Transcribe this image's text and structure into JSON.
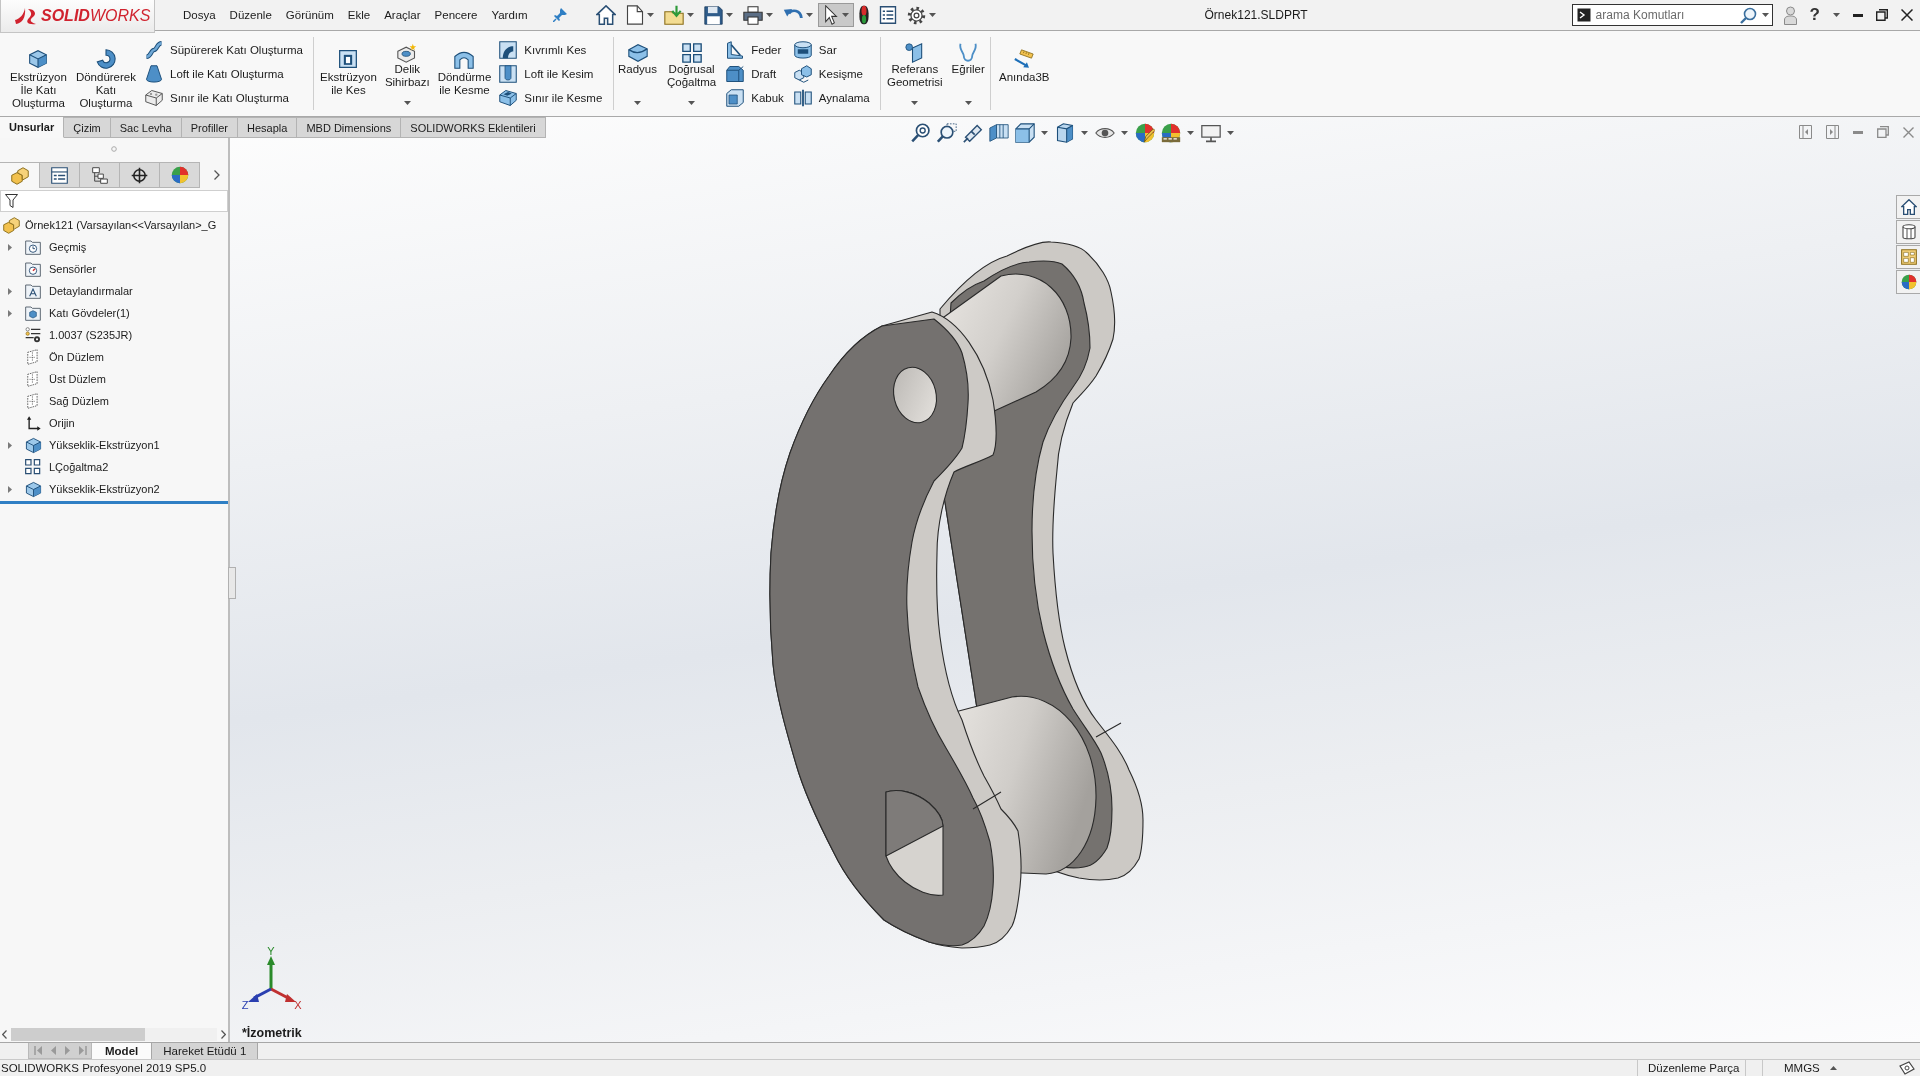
{
  "title_bar": {
    "logo": "**SOLID**WORKS",
    "menu": [
      "Dosya",
      "Düzenle",
      "Görünüm",
      "Ekle",
      "Araçlar",
      "Pencere",
      "Yardım"
    ],
    "quick_access": [
      {
        "kind": "home",
        "dropdown": false,
        "selected": false
      },
      {
        "kind": "new",
        "dropdown": true,
        "selected": false
      },
      {
        "kind": "open",
        "dropdown": true,
        "selected": false
      },
      {
        "kind": "save",
        "dropdown": true,
        "selected": false
      },
      {
        "kind": "print",
        "dropdown": true,
        "selected": false
      },
      {
        "kind": "undo",
        "dropdown": true,
        "selected": false
      },
      {
        "kind": "select",
        "dropdown": true,
        "selected": true
      },
      {
        "kind": "rebuild",
        "dropdown": false,
        "selected": false
      },
      {
        "kind": "properties",
        "dropdown": false,
        "selected": false
      },
      {
        "kind": "options",
        "dropdown": true,
        "selected": false
      }
    ],
    "document_title": "Örnek121.SLDPRT",
    "search": {
      "placeholder": "arama Komutları"
    },
    "help": "?"
  },
  "ribbon": {
    "groups": [
      {
        "items": [
          {
            "kind": "large",
            "label": "Ekstrüzyon\nİle Katı\nOluşturma",
            "dropdown": false
          },
          {
            "kind": "large",
            "label": "Döndürerek\nKatı\nOluşturma",
            "dropdown": false
          },
          {
            "kind": "stack",
            "labels": [
              "Süpürerek Katı Oluşturma",
              "Loft ile Katı Oluşturma",
              "Sınır ile Katı Oluşturma"
            ]
          }
        ]
      },
      {
        "items": [
          {
            "kind": "large",
            "label": "Ekstrüzyon\nile Kes",
            "dropdown": false
          },
          {
            "kind": "large",
            "label": "Delik\nSihirbazı",
            "dropdown": true
          },
          {
            "kind": "large",
            "label": "Döndürme\nile Kesme",
            "dropdown": false
          },
          {
            "kind": "stack",
            "labels": [
              "Kıvrımlı Kes",
              "Loft ile Kesim",
              "Sınır ile Kesme"
            ]
          }
        ]
      },
      {
        "items": [
          {
            "kind": "large",
            "label": "Radyus",
            "dropdown": true
          },
          {
            "kind": "large",
            "label": "Doğrusal\nÇoğaltma",
            "dropdown": true
          },
          {
            "kind": "stack",
            "labels": [
              "Feder",
              "Draft",
              "Kabuk"
            ]
          },
          {
            "kind": "stack",
            "labels": [
              "Sar",
              "Kesişme",
              "Aynalama"
            ]
          }
        ]
      },
      {
        "items": [
          {
            "kind": "large",
            "label": "Referans\nGeometrisi",
            "dropdown": true
          },
          {
            "kind": "large",
            "label": "Eğriler",
            "dropdown": true
          }
        ]
      },
      {
        "items": [
          {
            "kind": "large",
            "label": "Anında3B",
            "dropdown": false
          }
        ]
      }
    ]
  },
  "ribbon_tabs": [
    {
      "label": "Unsurlar",
      "selected": true
    },
    {
      "label": "Çizim",
      "selected": false
    },
    {
      "label": "Sac Levha",
      "selected": false
    },
    {
      "label": "Profiller",
      "selected": false
    },
    {
      "label": "Hesapla",
      "selected": false
    },
    {
      "label": "MBD Dimensions",
      "selected": false
    },
    {
      "label": "SOLIDWORKS Eklentileri",
      "selected": false
    }
  ],
  "feature_manager": {
    "tabs": [
      {
        "kind": "feature",
        "selected": true
      },
      {
        "kind": "property",
        "selected": false
      },
      {
        "kind": "configuration",
        "selected": false
      },
      {
        "kind": "dimxpert",
        "selected": false
      },
      {
        "kind": "display",
        "selected": false
      }
    ],
    "tree": {
      "label": "Örnek121  (Varsayılan<<Varsayılan>_G",
      "kind": "part",
      "expandable": false,
      "children": [
        {
          "label": "Geçmiş",
          "kind": "history",
          "expandable": true
        },
        {
          "label": "Sensörler",
          "kind": "sensors",
          "expandable": false
        },
        {
          "label": "Detaylandırmalar",
          "kind": "annotations",
          "expandable": true
        },
        {
          "label": "Katı Gövdeler(1)",
          "kind": "bodies",
          "expandable": true
        },
        {
          "label": "1.0037 (S235JR)",
          "kind": "material",
          "expandable": false
        },
        {
          "label": "Ön Düzlem",
          "kind": "plane",
          "expandable": false
        },
        {
          "label": "Üst Düzlem",
          "kind": "plane",
          "expandable": false
        },
        {
          "label": "Sağ Düzlem",
          "kind": "plane",
          "expandable": false
        },
        {
          "label": "Orijin",
          "kind": "origin",
          "expandable": false
        },
        {
          "label": "Yükseklik-Ekstrüzyon1",
          "kind": "extrude",
          "expandable": true
        },
        {
          "label": "LÇoğaltma2",
          "kind": "pattern",
          "expandable": false
        },
        {
          "label": "Yükseklik-Ekstrüzyon2",
          "kind": "extrude",
          "expandable": true
        }
      ]
    }
  },
  "viewport": {
    "view_label": "*İzometrik",
    "triad": {
      "x": "X",
      "y": "Y",
      "z": "Z"
    }
  },
  "bottom_tabs": [
    {
      "label": "Model",
      "selected": true
    },
    {
      "label": "Hareket Etüdü 1",
      "selected": false
    }
  ],
  "status_bar": {
    "product": "SOLIDWORKS Profesyonel 2019 SP5.0",
    "mode": "Düzenleme Parça",
    "units": "MMGS"
  }
}
